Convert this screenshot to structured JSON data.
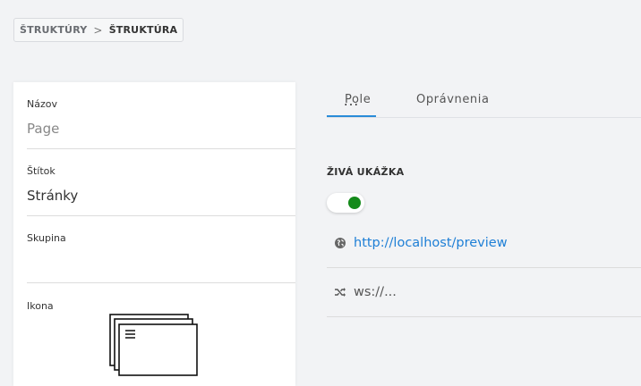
{
  "breadcrumb": {
    "parent": "ŠTRUKTÚRY",
    "separator": ">",
    "current": "ŠTRUKTÚRA"
  },
  "form": {
    "name_label": "Názov",
    "name_value": "Page",
    "tag_label": "Štítok",
    "tag_value": "Stránky",
    "group_label": "Skupina",
    "group_value": "",
    "icon_label": "Ikona",
    "icon_name": "windows-stack-icon"
  },
  "tabs": [
    {
      "label": "Pole",
      "active": false
    },
    {
      "label": "Oprávnenia",
      "active": false
    },
    {
      "label": "...",
      "active": true
    }
  ],
  "live_preview": {
    "title": "ŽIVÁ UKÁŽKA",
    "enabled": true,
    "url": "http://localhost/preview",
    "url_icon": "globe-icon",
    "ws": "ws://...",
    "ws_icon": "shuffle-icon"
  },
  "colors": {
    "accent": "#2a8cd8",
    "link": "#1e7fd6",
    "toggle_on": "#148a1a",
    "background": "#f2f3f5"
  }
}
